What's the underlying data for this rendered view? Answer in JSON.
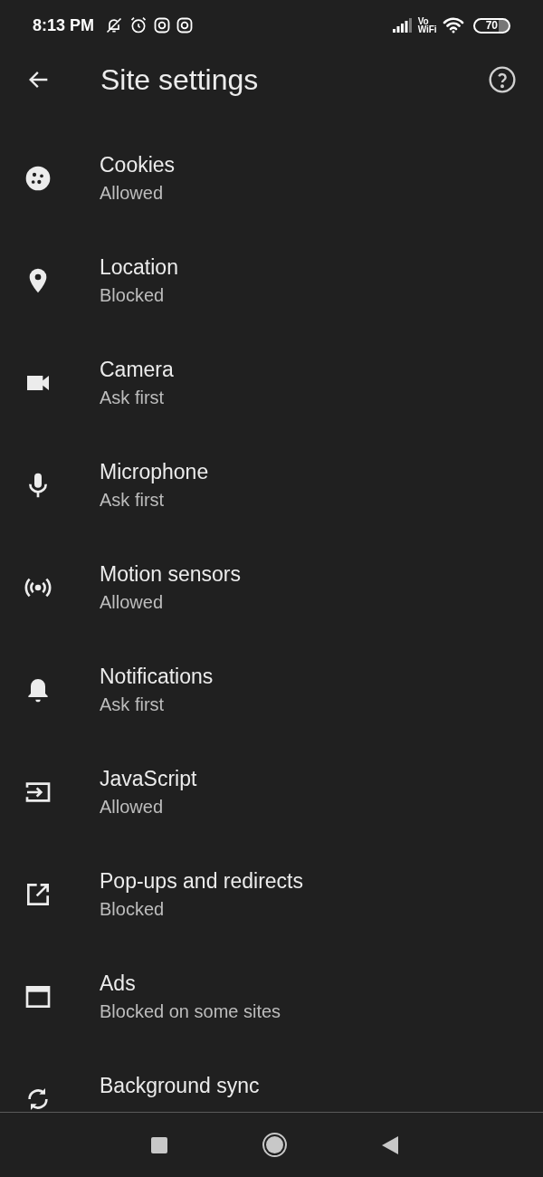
{
  "status_bar": {
    "time": "8:13 PM",
    "network_top": "Vo",
    "network_bottom": "WiFi",
    "battery": "70"
  },
  "header": {
    "title": "Site settings"
  },
  "settings": [
    {
      "title": "Cookies",
      "subtitle": "Allowed"
    },
    {
      "title": "Location",
      "subtitle": "Blocked"
    },
    {
      "title": "Camera",
      "subtitle": "Ask first"
    },
    {
      "title": "Microphone",
      "subtitle": "Ask first"
    },
    {
      "title": "Motion sensors",
      "subtitle": "Allowed"
    },
    {
      "title": "Notifications",
      "subtitle": "Ask first"
    },
    {
      "title": "JavaScript",
      "subtitle": "Allowed"
    },
    {
      "title": "Pop-ups and redirects",
      "subtitle": "Blocked"
    },
    {
      "title": "Ads",
      "subtitle": "Blocked on some sites"
    },
    {
      "title": "Background sync"
    }
  ]
}
